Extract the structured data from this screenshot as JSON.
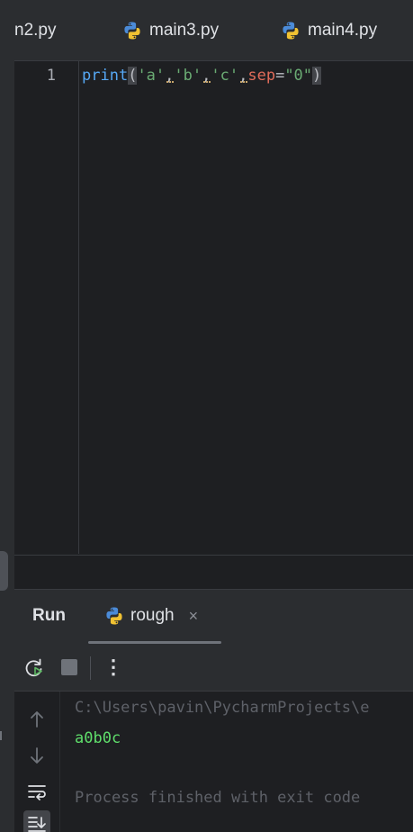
{
  "editor_tabs": [
    {
      "label": "n2.py",
      "icon": "python-file-icon"
    },
    {
      "label": "main3.py",
      "icon": "python-file-icon"
    },
    {
      "label": "main4.py",
      "icon": "python-file-icon"
    }
  ],
  "editor": {
    "line_number": "1",
    "code": {
      "fn": "print",
      "open_paren": "(",
      "arg1": "'a'",
      "comma1": ",",
      "arg2": "'b'",
      "comma2": ",",
      "arg3": "'c'",
      "comma3": ",",
      "kw": "sep",
      "eq": "=",
      "kw_value": "\"0\"",
      "close_paren": ")"
    }
  },
  "run_panel": {
    "title": "Run",
    "tab_label": "rough",
    "tab_close": "×",
    "more_glyph": "⋮",
    "console_lines": {
      "command": "C:\\Users\\pavin\\PycharmProjects\\e",
      "output": "a0b0c",
      "exit": "Process finished with exit code"
    }
  },
  "colors": {
    "background": "#1e1f22",
    "panel": "#2b2d30",
    "function": "#56a8f5",
    "string": "#6aab73",
    "keyword_arg": "#e06c5a",
    "output_green": "#5fde6b"
  }
}
